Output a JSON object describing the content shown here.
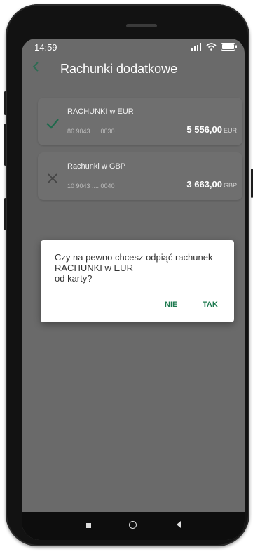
{
  "status": {
    "time": "14:59"
  },
  "appbar": {
    "title": "Rachunki dodatkowe"
  },
  "accounts": [
    {
      "name": "RACHUNKI w EUR",
      "number": "86 9043 .... 0030",
      "amount": "5 556,00",
      "currency": "EUR",
      "selected": true
    },
    {
      "name": "Rachunki w GBP",
      "number": "10 9043 .... 0040",
      "amount": "3 663,00",
      "currency": "GBP",
      "selected": false
    }
  ],
  "dialog": {
    "line1": "Czy na pewno chcesz odpiąć rachunek",
    "line2": "RACHUNKI w EUR",
    "line3": "od karty?",
    "no_label": "NIE",
    "yes_label": "TAK"
  },
  "colors": {
    "accent": "#1d7a4f"
  }
}
